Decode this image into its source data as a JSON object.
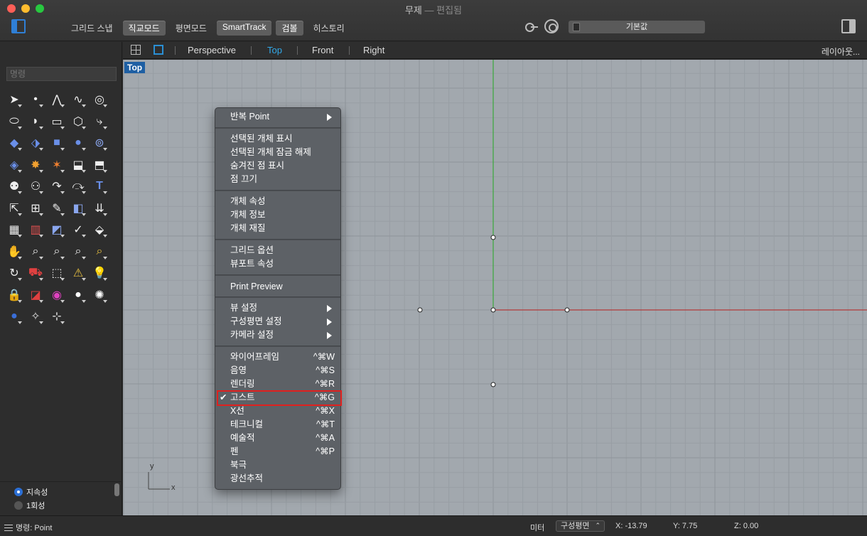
{
  "window": {
    "title": "무제",
    "subtitle": "— 편집됨",
    "modes": [
      {
        "label": "그리드 스냅",
        "on": false
      },
      {
        "label": "직교모드",
        "on": true
      },
      {
        "label": "평면모드",
        "on": false
      },
      {
        "label": "SmartTrack",
        "on": true
      },
      {
        "label": "검볼",
        "on": true
      },
      {
        "label": "히스토리",
        "on": false
      }
    ],
    "layer": "기본값"
  },
  "sidebar": {
    "command_placeholder": "명령",
    "osnap": [
      {
        "label": "지속성",
        "selected": true
      },
      {
        "label": "1회성",
        "selected": false
      }
    ]
  },
  "viewport_tabs": {
    "tabs": [
      "Perspective",
      "Top",
      "Front",
      "Right"
    ],
    "active": "Top",
    "layout_label": "레이아웃..."
  },
  "viewport": {
    "label": "Top",
    "axis_y": "y",
    "axis_x": "x",
    "colors": {
      "background": "#a2a8ae",
      "x_axis": "#b23a3a",
      "y_axis": "#3aa83a"
    }
  },
  "context_menu": {
    "items": [
      {
        "label": "반복 Point",
        "submenu": true
      },
      {
        "label": "선택된 개체 표시"
      },
      {
        "label": "선택된 개체 잠금 해제"
      },
      {
        "label": "숨겨진 점 표시"
      },
      {
        "label": "점 끄기"
      },
      {
        "label": "개체 속성"
      },
      {
        "label": "개체 정보"
      },
      {
        "label": "개체 재질"
      },
      {
        "label": "그리드 옵션"
      },
      {
        "label": "뷰포트 속성"
      },
      {
        "label": "Print Preview"
      },
      {
        "label": "뷰 설정",
        "submenu": true
      },
      {
        "label": "구성평면 설정",
        "submenu": true
      },
      {
        "label": "카메라 설정",
        "submenu": true
      },
      {
        "label": "와이어프레임",
        "shortcut": "^⌘W"
      },
      {
        "label": "음영",
        "shortcut": "^⌘S"
      },
      {
        "label": "렌더링",
        "shortcut": "^⌘R"
      },
      {
        "label": "고스트",
        "shortcut": "^⌘G",
        "checked": true,
        "highlighted": true
      },
      {
        "label": "X선",
        "shortcut": "^⌘X"
      },
      {
        "label": "테크니컬",
        "shortcut": "^⌘T"
      },
      {
        "label": "예술적",
        "shortcut": "^⌘A"
      },
      {
        "label": "펜",
        "shortcut": "^⌘P"
      },
      {
        "label": "북극"
      },
      {
        "label": "광선추적"
      }
    ]
  },
  "statusbar": {
    "prompt": "명령: Point",
    "units": "미터",
    "cplane": "구성평면",
    "x": "X: -13.79",
    "y": "Y: 7.75",
    "z": "Z: 0.00"
  }
}
